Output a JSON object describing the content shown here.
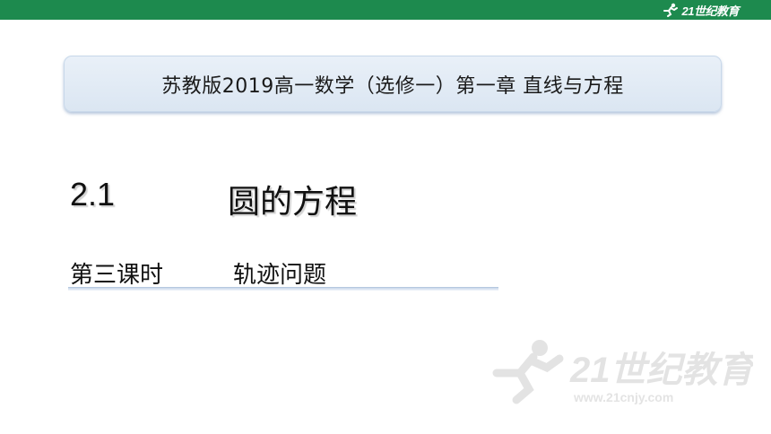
{
  "brand": {
    "logo_text": "21世纪教育",
    "logo_subtext": "www.21cnjy.com",
    "bar_color": "#1d8a4e"
  },
  "header": {
    "title": "苏教版2019高一数学（选修一）第一章  直线与方程"
  },
  "section": {
    "number": "2.1",
    "title": "圆的方程"
  },
  "lesson": {
    "period": "第三课时",
    "topic": "轨迹问题"
  },
  "watermark": {
    "text": "21世纪教育",
    "icon": "runner-icon"
  }
}
